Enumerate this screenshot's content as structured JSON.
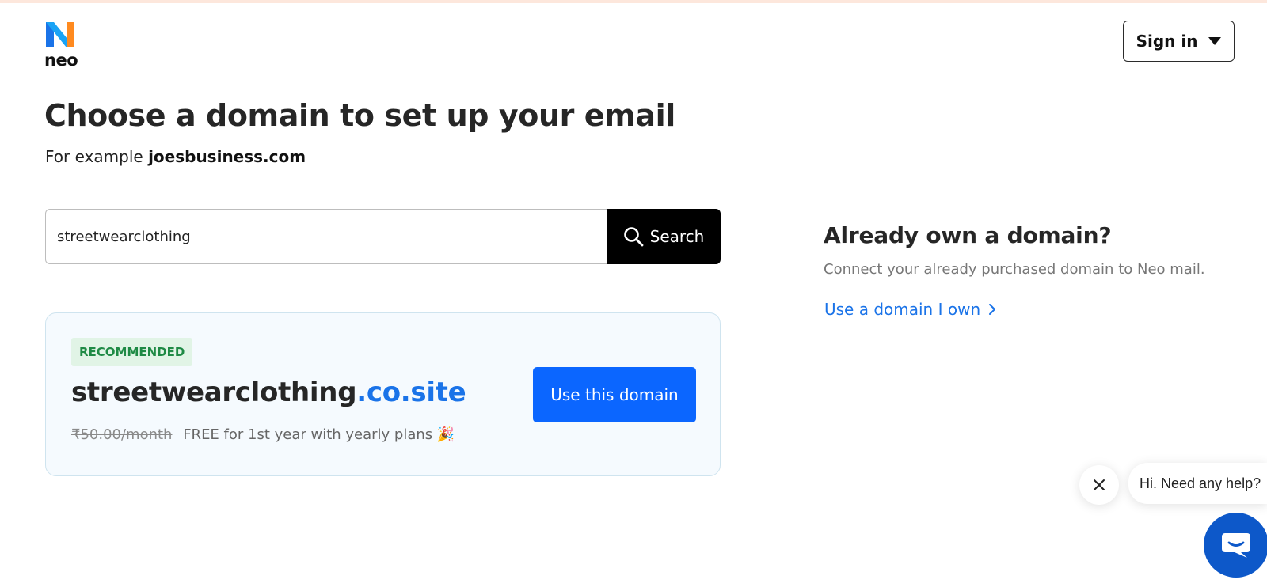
{
  "brand": {
    "name": "neo"
  },
  "header": {
    "signin_label": "Sign in"
  },
  "page": {
    "title": "Choose a domain to set up your email",
    "example_prefix": "For example",
    "example_domain": "joesbusiness.com"
  },
  "search": {
    "value": "streetwearclothing",
    "button_label": "Search"
  },
  "recommendation": {
    "badge": "RECOMMENDED",
    "domain_name": "streetwearclothing",
    "domain_tld": ".co.site",
    "old_price": "₹50.00/month",
    "offer_text": "FREE for 1st year with yearly plans 🎉",
    "button_label": "Use this domain"
  },
  "own_domain": {
    "title": "Already own a domain?",
    "description": "Connect your already purchased domain to Neo mail.",
    "link_label": "Use a domain I own"
  },
  "chat": {
    "greeting": "Hi. Need any help?"
  },
  "colors": {
    "accent_blue": "#0b66ff",
    "link_blue": "#1a73e8",
    "badge_green": "#1f8a45",
    "chat_blue": "#0d58c9"
  },
  "icons": [
    "neo-logo-icon",
    "caret-down-icon",
    "search-icon",
    "chevron-right-icon",
    "close-icon",
    "chat-icon"
  ]
}
